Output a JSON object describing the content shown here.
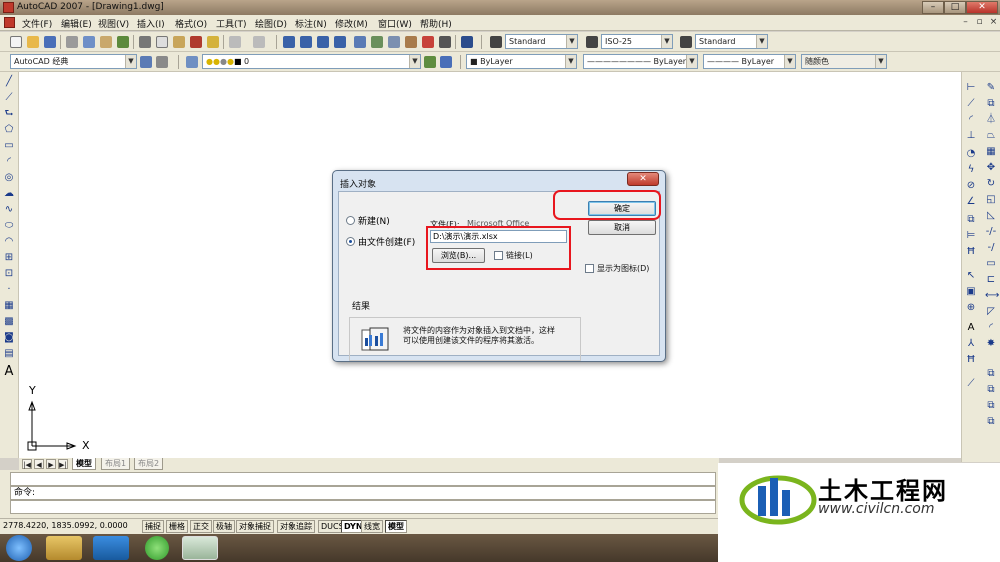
{
  "window": {
    "title": "AutoCAD 2007 - [Drawing1.dwg]",
    "min": "–",
    "max": "□",
    "close": "✕"
  },
  "menu": {
    "items": [
      "文件(F)",
      "编辑(E)",
      "视图(V)",
      "插入(I)",
      "格式(O)",
      "工具(T)",
      "绘图(D)",
      "标注(N)",
      "修改(M)",
      "窗口(W)",
      "帮助(H)"
    ],
    "mdi": {
      "min": "–",
      "restore": "▫",
      "close": "×"
    }
  },
  "toolbar1": {
    "text_style": "Standard",
    "dim_style": "ISO-25",
    "table_style": "Standard"
  },
  "toolbar2": {
    "workspace": "AutoCAD 经典",
    "layer": "0",
    "color": "ByLayer",
    "linetype": "ByLayer",
    "lineweight": "ByLayer",
    "plotstyle": "随颜色"
  },
  "ucs": {
    "x_label": "X",
    "y_label": "Y"
  },
  "tabs": {
    "model": "模型",
    "layout1": "布局1",
    "layout2": "布局2"
  },
  "command": {
    "prompt": "命令:"
  },
  "status": {
    "coords": "2778.4220, 1835.0992, 0.0000",
    "buttons": [
      "捕捉",
      "栅格",
      "正交",
      "极轴",
      "对象捕捉",
      "对象追踪",
      "DUCS",
      "DYN",
      "线宽",
      "模型"
    ]
  },
  "dialog": {
    "title": "插入对象",
    "close": "✕",
    "option_new": "新建(N)",
    "option_from_file": "由文件创建(F)",
    "file_label": "文件(F):",
    "file_type": "Microsoft Office",
    "file_path": "D:\\演示\\演示.xlsx",
    "browse_button": "浏览(B)...",
    "link_label": "链接(L)",
    "ok_button": "确定",
    "cancel_button": "取消",
    "display_as_icon": "显示为图标(D)",
    "result_title": "结果",
    "result_text_1": "将文件的内容作为对象插入到文档中，这样",
    "result_text_2": "可以使用创建该文件的程序将其激活。"
  },
  "watermark": {
    "brand": "土木工程网",
    "url": "www.civilcn.com"
  },
  "colors": {
    "highlight": "#e8161e",
    "brand_blue": "#1b5fb5",
    "brand_green": "#7ab51d"
  }
}
